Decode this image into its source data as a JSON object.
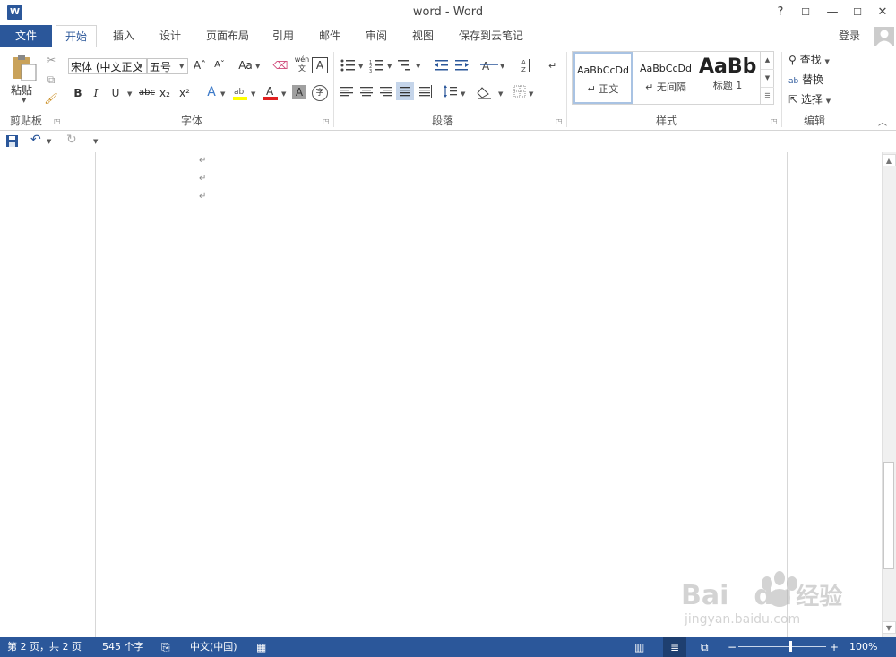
{
  "window": {
    "title": "word - Word",
    "help": "?",
    "ribbon_display": "☐",
    "minimize": "—",
    "maximize": "☐",
    "close": "✕",
    "app_icon_text": "W"
  },
  "tabs": {
    "file": "文件",
    "items": [
      "开始",
      "插入",
      "设计",
      "页面布局",
      "引用",
      "邮件",
      "审阅",
      "视图",
      "保存到云笔记"
    ],
    "login": "登录"
  },
  "clipboard": {
    "paste": "粘贴",
    "label": "剪贴板"
  },
  "font": {
    "font_name": "宋体 (中文正文",
    "font_size": "五号",
    "grow": "Aˆ",
    "shrink": "Aˇ",
    "change_case": "Aa",
    "phonetic": "wén",
    "bold": "B",
    "italic": "I",
    "underline": "U",
    "strike": "abc",
    "subscript": "x₂",
    "superscript": "x²",
    "label": "字体",
    "char_border": "A",
    "enclose": "字"
  },
  "paragraph": {
    "label": "段落"
  },
  "styles": {
    "items": [
      {
        "preview": "AaBbCcDd",
        "name": "↵ 正文"
      },
      {
        "preview": "AaBbCcDd",
        "name": "↵ 无间隔"
      },
      {
        "preview": "AaBb",
        "name": "标题 1"
      }
    ],
    "label": "样式"
  },
  "editing": {
    "find": "查找",
    "replace": "替换",
    "select": "选择",
    "label": "编辑"
  },
  "document": {
    "paragraph_marks": [
      "↵",
      "↵",
      "↵"
    ]
  },
  "status": {
    "page": "第 2 页，共 2 页",
    "words": "545 个字",
    "language": "中文(中国)",
    "zoom": "100%",
    "zoom_level": 1.0
  },
  "watermark": {
    "brand": "Bai",
    "brand2": "du",
    "cn": "经验",
    "url": "jingyan.baidu.com"
  },
  "colors": {
    "accent": "#2b579a",
    "highlight": "#ffff00",
    "font_color": "#e02020"
  }
}
